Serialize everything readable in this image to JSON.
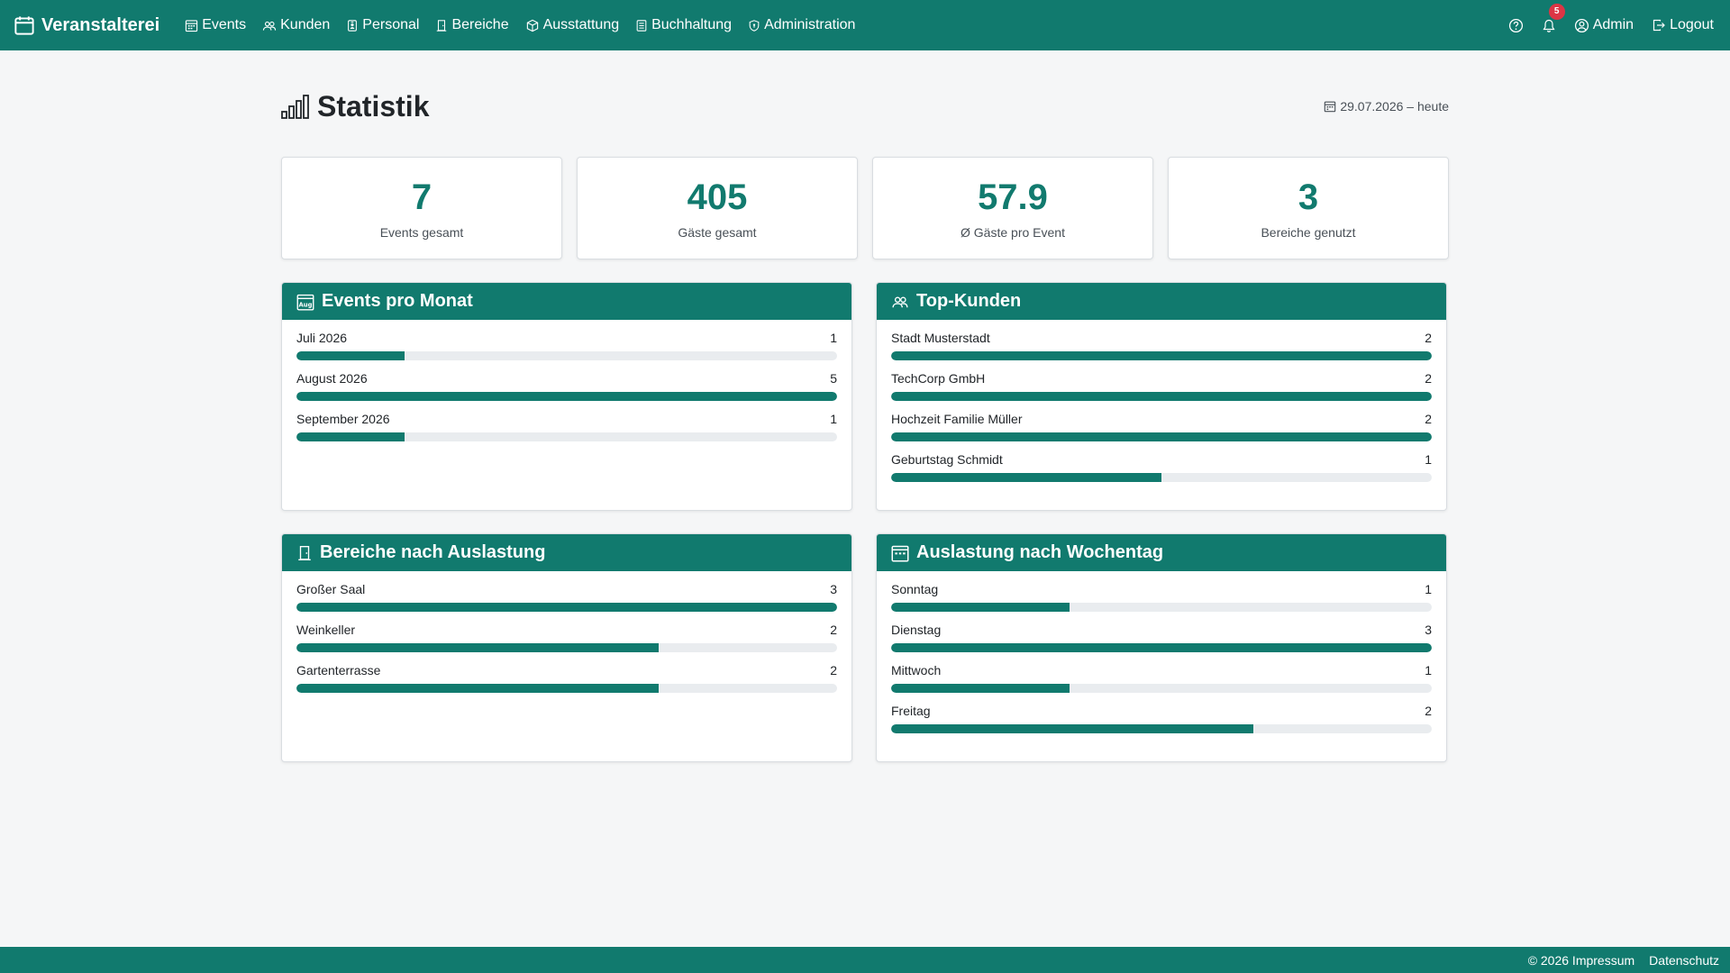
{
  "nav": {
    "brand": "Veranstalterei",
    "items": [
      {
        "label": "Events",
        "icon": "calendar-grid-icon"
      },
      {
        "label": "Kunden",
        "icon": "people-icon"
      },
      {
        "label": "Personal",
        "icon": "person-badge-icon"
      },
      {
        "label": "Bereiche",
        "icon": "door-icon"
      },
      {
        "label": "Ausstattung",
        "icon": "box-icon"
      },
      {
        "label": "Buchhaltung",
        "icon": "ledger-icon"
      },
      {
        "label": "Administration",
        "icon": "shield-icon"
      }
    ],
    "notification_count": "5",
    "user_label": "Admin",
    "logout_label": "Logout"
  },
  "page": {
    "title": "Statistik",
    "date_range": "29.07.2026 – heute"
  },
  "stats": [
    {
      "value": "7",
      "label": "Events gesamt"
    },
    {
      "value": "405",
      "label": "Gäste gesamt"
    },
    {
      "value": "57.9",
      "label": "Ø Gäste pro Event"
    },
    {
      "value": "3",
      "label": "Bereiche genutzt"
    }
  ],
  "panels": {
    "events_per_month": {
      "title": "Events pro Monat",
      "items": [
        {
          "label": "Juli 2026",
          "value": "1",
          "fraction": 0.2
        },
        {
          "label": "August 2026",
          "value": "5",
          "fraction": 1.0
        },
        {
          "label": "September 2026",
          "value": "1",
          "fraction": 0.2
        }
      ]
    },
    "top_customers": {
      "title": "Top-Kunden",
      "items": [
        {
          "label": "Stadt Musterstadt",
          "value": "2",
          "fraction": 1.0
        },
        {
          "label": "TechCorp GmbH",
          "value": "2",
          "fraction": 1.0
        },
        {
          "label": "Hochzeit Familie Müller",
          "value": "2",
          "fraction": 1.0
        },
        {
          "label": "Geburtstag Schmidt",
          "value": "1",
          "fraction": 0.5
        }
      ]
    },
    "areas_by_usage": {
      "title": "Bereiche nach Auslastung",
      "items": [
        {
          "label": "Großer Saal",
          "value": "3",
          "fraction": 1.0
        },
        {
          "label": "Weinkeller",
          "value": "2",
          "fraction": 0.67
        },
        {
          "label": "Gartenterrasse",
          "value": "2",
          "fraction": 0.67
        }
      ]
    },
    "usage_by_weekday": {
      "title": "Auslastung nach Wochentag",
      "items": [
        {
          "label": "Sonntag",
          "value": "1",
          "fraction": 0.33
        },
        {
          "label": "Dienstag",
          "value": "3",
          "fraction": 1.0
        },
        {
          "label": "Mittwoch",
          "value": "1",
          "fraction": 0.33
        },
        {
          "label": "Freitag",
          "value": "2",
          "fraction": 0.67
        }
      ]
    }
  },
  "footer": {
    "impressum": "© 2026 Impressum",
    "datenschutz": "Datenschutz"
  },
  "colors": {
    "primary": "#117a6e",
    "badge": "#dc3545",
    "track": "#e9ecef"
  }
}
